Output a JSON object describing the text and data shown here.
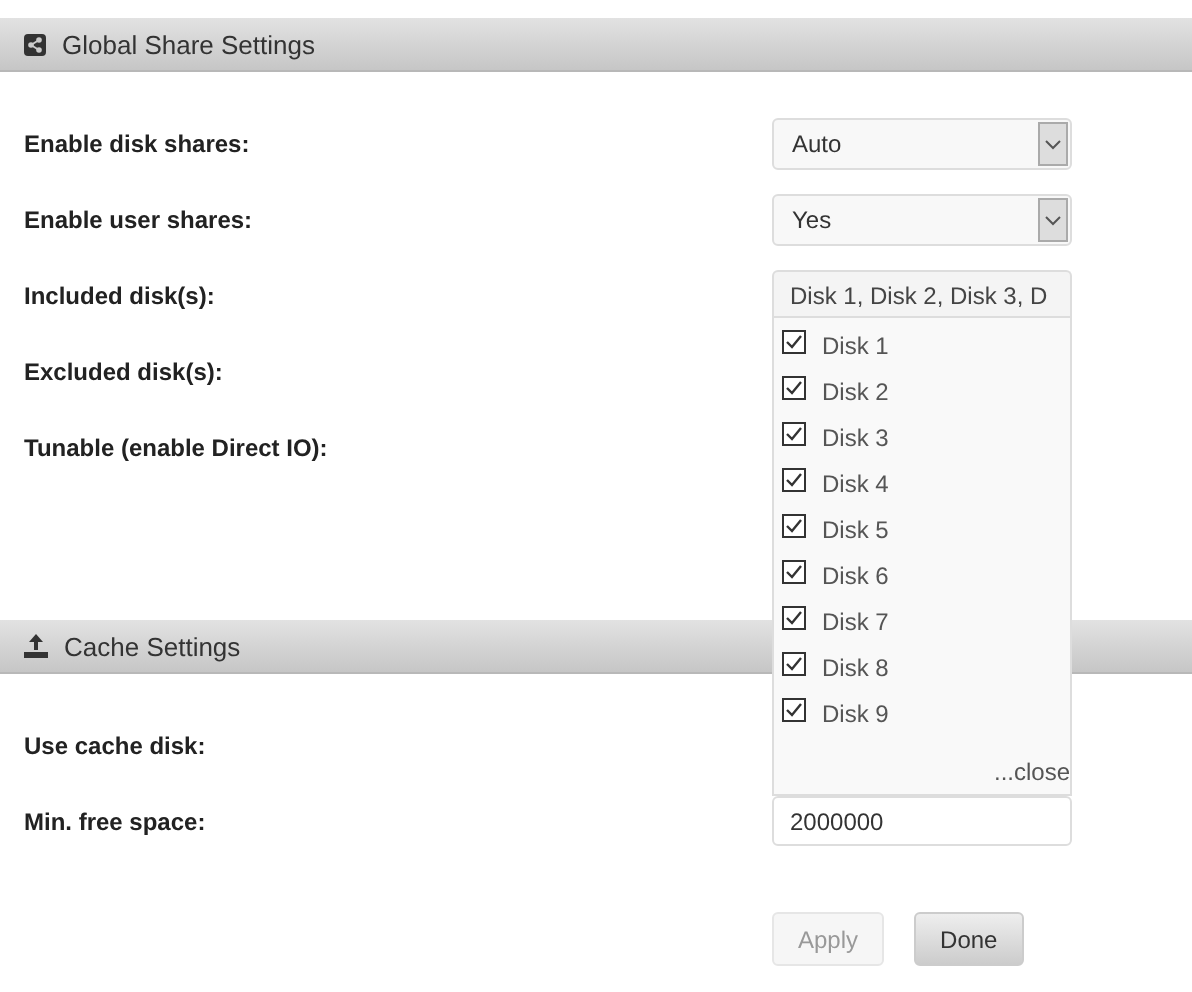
{
  "sections": [
    {
      "title": "Global Share Settings",
      "kind": "share",
      "rows": [
        {
          "label": "Enable disk shares:",
          "kind": "select",
          "value": "Auto"
        },
        {
          "label": "Enable user shares:",
          "kind": "select",
          "value": "Yes"
        },
        {
          "label": "Included disk(s):",
          "kind": "multiselect",
          "value": "Disk 1, Disk 2, Disk 3, D",
          "expanded": true,
          "options": [
            {
              "label": "Disk 1",
              "checked": true
            },
            {
              "label": "Disk 2",
              "checked": true
            },
            {
              "label": "Disk 3",
              "checked": true
            },
            {
              "label": "Disk 4",
              "checked": true
            },
            {
              "label": "Disk 5",
              "checked": true
            },
            {
              "label": "Disk 6",
              "checked": true
            },
            {
              "label": "Disk 7",
              "checked": true
            },
            {
              "label": "Disk 8",
              "checked": true
            },
            {
              "label": "Disk 9",
              "checked": true
            }
          ],
          "close_label": "...close"
        },
        {
          "label": "Excluded disk(s):",
          "kind": "label"
        },
        {
          "label": "Tunable (enable Direct IO):",
          "kind": "label"
        }
      ]
    },
    {
      "title": "Cache Settings",
      "kind": "upload",
      "rows": [
        {
          "label": "Use cache disk:",
          "kind": "label"
        },
        {
          "label": "Min. free space:",
          "kind": "text",
          "value": "2000000"
        }
      ]
    }
  ],
  "buttons": [
    {
      "label": "Apply",
      "disabled": true
    },
    {
      "label": "Done",
      "disabled": false
    }
  ]
}
